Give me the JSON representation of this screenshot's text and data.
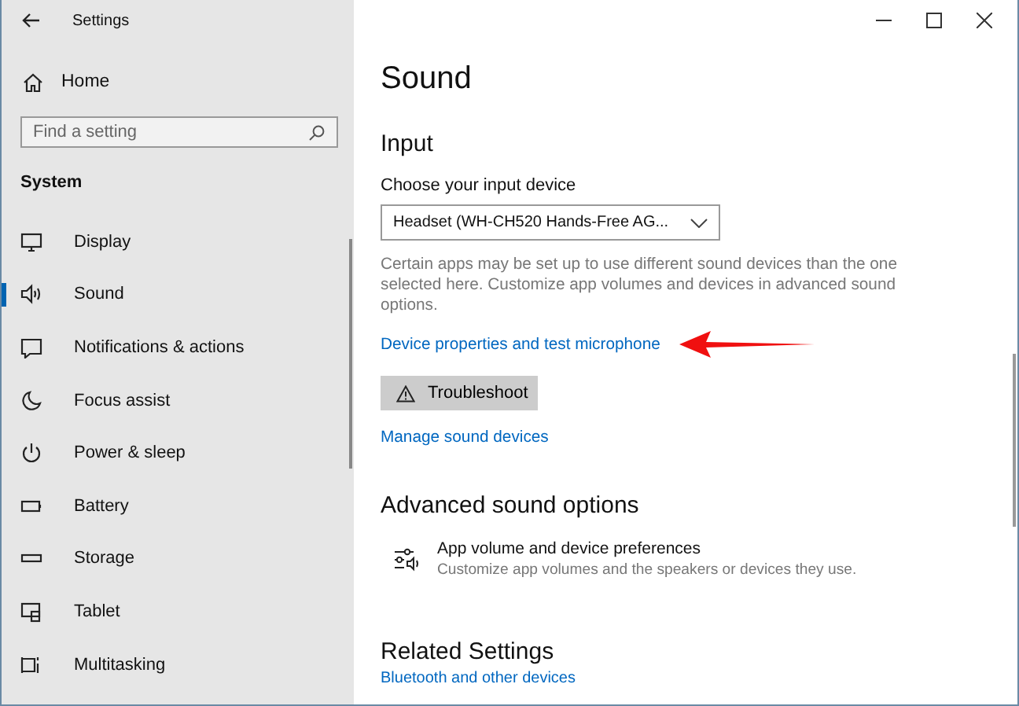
{
  "window": {
    "title": "Settings"
  },
  "sidebar": {
    "home": "Home",
    "search": {
      "placeholder": "Find a setting"
    },
    "section": "System",
    "items": [
      {
        "label": "Display",
        "selected": false
      },
      {
        "label": "Sound",
        "selected": true
      },
      {
        "label": "Notifications & actions",
        "selected": false
      },
      {
        "label": "Focus assist",
        "selected": false
      },
      {
        "label": "Power & sleep",
        "selected": false
      },
      {
        "label": "Battery",
        "selected": false
      },
      {
        "label": "Storage",
        "selected": false
      },
      {
        "label": "Tablet",
        "selected": false
      },
      {
        "label": "Multitasking",
        "selected": false
      }
    ]
  },
  "page": {
    "title": "Sound",
    "input": {
      "heading": "Input",
      "device_label": "Choose your input device",
      "device_value": "Headset (WH-CH520 Hands-Free AG...",
      "description": "Certain apps may be set up to use different sound devices than the one selected here. Customize app volumes and devices in advanced sound options.",
      "properties_link": "Device properties and test microphone",
      "troubleshoot_button": "Troubleshoot",
      "manage_link": "Manage sound devices"
    },
    "advanced": {
      "heading": "Advanced sound options",
      "item_title": "App volume and device preferences",
      "item_description": "Customize app volumes and the speakers or devices they use."
    },
    "related": {
      "heading": "Related Settings",
      "links": [
        "Bluetooth and other devices"
      ]
    }
  }
}
